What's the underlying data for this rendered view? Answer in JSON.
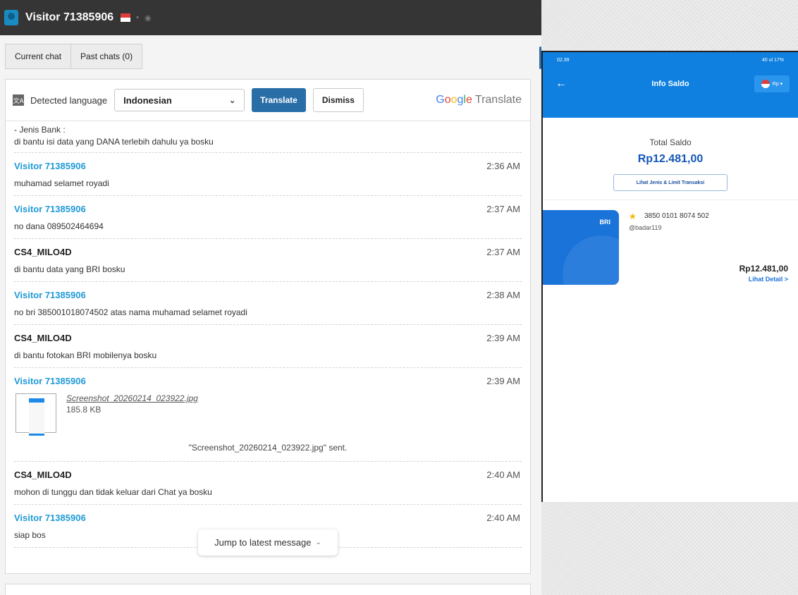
{
  "header": {
    "visitor_title": "Visitor 71385906"
  },
  "tabs": [
    {
      "label": "Current chat"
    },
    {
      "label": "Past chats (0)"
    }
  ],
  "translate_bar": {
    "icon_text": "文A",
    "detected_label": "Detected language",
    "selected_language": "Indonesian",
    "translate_button": "Translate",
    "dismiss_button": "Dismiss",
    "logo_letters": [
      "G",
      "o",
      "o",
      "g",
      "l",
      "e"
    ],
    "logo_word": "Translate"
  },
  "first_message": {
    "line1": "- Jenis Bank :",
    "line2": "di bantu isi data yang DANA terlebih dahulu ya bosku"
  },
  "messages": [
    {
      "sender": "Visitor 71385906",
      "time": "2:36 AM",
      "text": "muhamad selamet royadi"
    },
    {
      "sender": "Visitor 71385906",
      "time": "2:37 AM",
      "text": "no dana 089502464694"
    },
    {
      "sender": "CS4_MILO4D",
      "time": "2:37 AM",
      "text": "di bantu data yang BRI bosku"
    },
    {
      "sender": "Visitor 71385906",
      "time": "2:38 AM",
      "text": "no bri 385001018074502 atas nama muhamad selamet royadi"
    },
    {
      "sender": "CS4_MILO4D",
      "time": "2:39 AM",
      "text": "di bantu fotokan BRI mobilenya bosku"
    },
    {
      "sender": "Visitor 71385906",
      "time": "2:39 AM",
      "file_name": "Screenshot_20260214_023922.jpg",
      "file_size": "185.8 KB",
      "sent_note": "\"Screenshot_20260214_023922.jpg\" sent."
    },
    {
      "sender": "CS4_MILO4D",
      "time": "2:40 AM",
      "text": "mohon di tunggu dan tidak keluar dari Chat ya bosku"
    },
    {
      "sender": "Visitor 71385906",
      "time": "2:40 AM",
      "text": "siap bos"
    }
  ],
  "jump_button": "Jump to latest message",
  "phone": {
    "status_time": "02.39",
    "status_right": "40 ul 17%",
    "title": "Info Saldo",
    "currency": "Rp",
    "total_label": "Total Saldo",
    "total_amount": "Rp12.481,00",
    "limit_button": "Lihat Jenis & Limit Transaksi",
    "bank_label": "BRI",
    "account_number": "3850 0101 8074 502",
    "account_user": "@badar119",
    "account_balance": "Rp12.481,00",
    "detail_link": "Lihat Detail >"
  },
  "colors": {
    "topbar": "#353535",
    "visitor_name": "#1f9ad6",
    "translate_button": "#2a6ea8",
    "phone_header": "#0f80e0",
    "total_amount": "#1456b8"
  }
}
